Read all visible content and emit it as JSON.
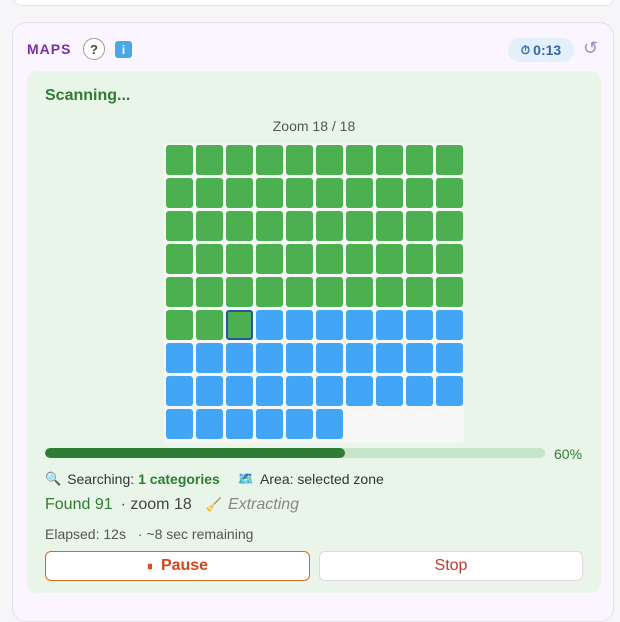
{
  "panel": {
    "title": "MAPS",
    "help_label": "?",
    "info_label": "i",
    "timer": "0:13",
    "icons": {
      "help": "question-icon",
      "info": "info-icon",
      "timer": "stopwatch-icon",
      "reset": "reset-icon"
    }
  },
  "scan": {
    "status": "Scanning...",
    "zoom_label": "Zoom 18 / 18",
    "grid": {
      "cols": 10,
      "total_tiles": 86,
      "completed_tiles": 52,
      "current_tile": 53
    },
    "progress": 0.6,
    "progress_text": "60%",
    "search_prefix": "Searching:",
    "search_value": "1 categories",
    "area_text": "Area: selected zone",
    "found_text": "Found 91",
    "zoom_text": "· zoom 18",
    "stage_text": "Extracting",
    "elapsed_text": "Elapsed: 12s",
    "remaining_text": "· ~8 sec remaining",
    "colors": {
      "done": "#4caf50",
      "pending": "#42a5f5",
      "accent": "#2e7d32"
    }
  },
  "actions": {
    "pause_label": "Pause",
    "stop_label": "Stop"
  }
}
